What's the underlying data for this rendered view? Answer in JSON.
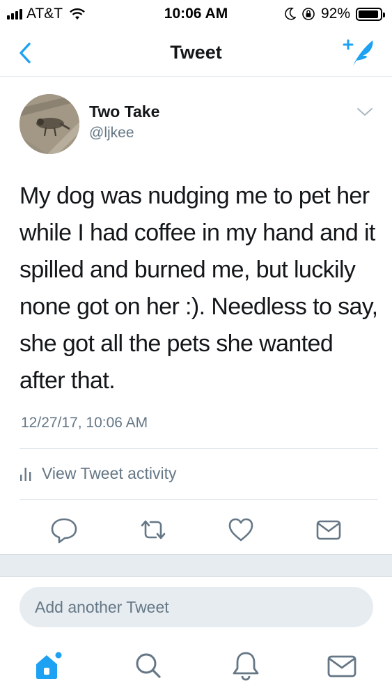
{
  "status_bar": {
    "carrier": "AT&T",
    "time": "10:06 AM",
    "battery_percent": "92%",
    "battery_level": 0.92
  },
  "nav": {
    "title": "Tweet",
    "back_icon": "chevron-left-icon",
    "compose_icon": "compose-tweet-icon"
  },
  "tweet": {
    "author_name": "Two Take",
    "author_handle": "@ljkee",
    "text": "My dog was nudging me to pet her while I had coffee in my hand and it spilled and burned me, but luckily none got on her :). Needless to say, she got all the pets she wanted after that.",
    "timestamp": "12/27/17, 10:06 AM"
  },
  "activity": {
    "label": "View Tweet activity"
  },
  "actions": [
    "reply-icon",
    "retweet-icon",
    "like-icon",
    "direct-message-icon"
  ],
  "compose": {
    "placeholder": "Add another Tweet"
  },
  "tabbar": [
    "home-icon",
    "search-icon",
    "notifications-icon",
    "messages-icon"
  ],
  "colors": {
    "accent": "#1da1f2",
    "text_primary": "#14171a",
    "text_secondary": "#657786",
    "divider": "#e1e8ed",
    "band": "#e6ecf0"
  }
}
